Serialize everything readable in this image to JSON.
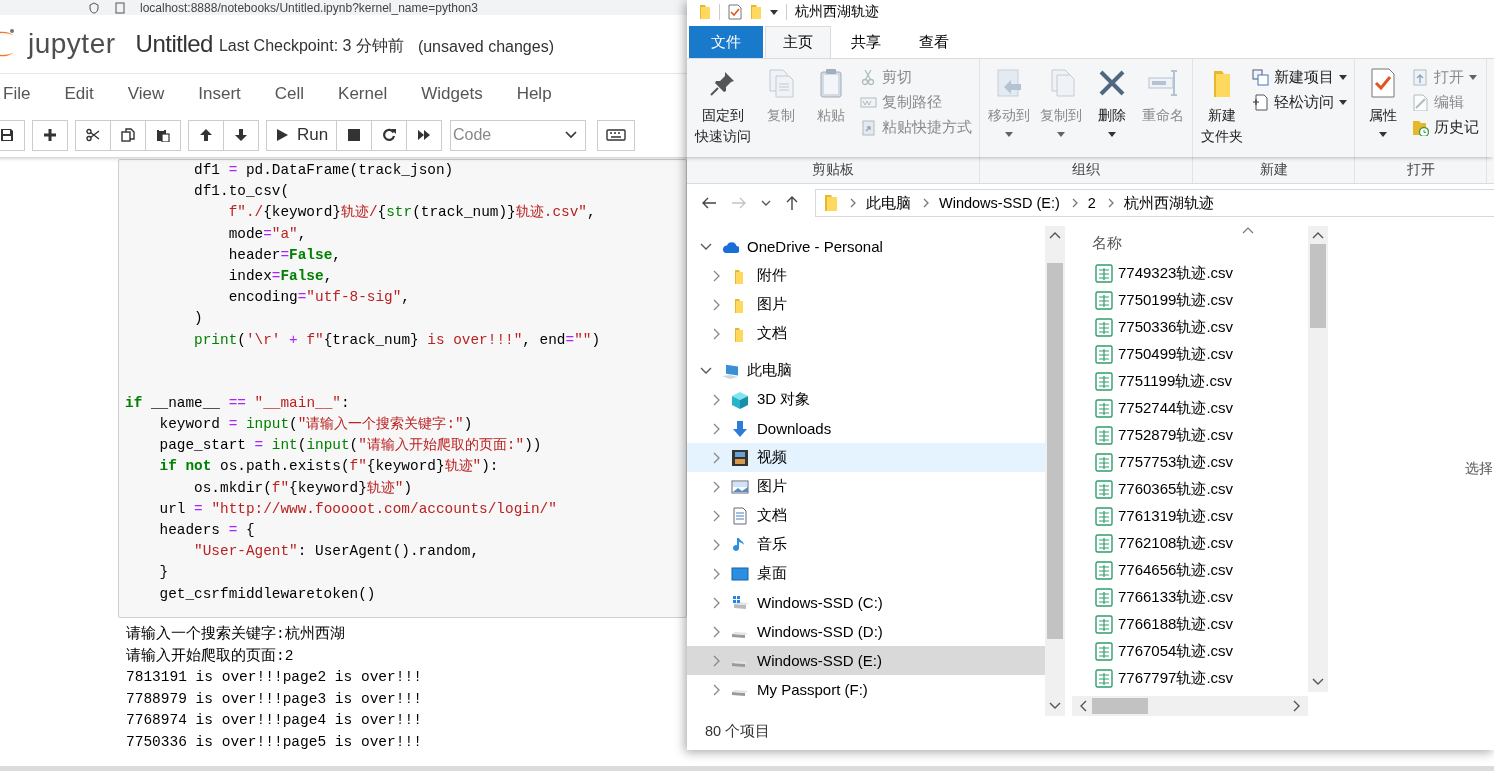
{
  "browser": {
    "url": "localhost:8888/notebooks/Untitled.ipynb?kernel_name=python3"
  },
  "jupyter": {
    "logo": "jupyter",
    "title": "Untitled",
    "checkpoint": "Last Checkpoint: 3 分钟前",
    "unsaved": "(unsaved changes)",
    "menu": [
      "File",
      "Edit",
      "View",
      "Insert",
      "Cell",
      "Kernel",
      "Widgets",
      "Help"
    ],
    "toolbar": {
      "run_label": "Run",
      "cell_type": "Code"
    },
    "code_blocks": [
      {
        "lines": [
          [
            {
              "kind": "plain",
              "text": "        df1 "
            },
            {
              "kind": "op",
              "text": "= "
            },
            {
              "kind": "plain",
              "text": "pd.DataFrame(track_json)"
            }
          ],
          [
            {
              "kind": "plain",
              "text": "        df1.to_csv("
            }
          ],
          [
            {
              "kind": "str",
              "text": "            f\"./"
            },
            {
              "kind": "plain",
              "text": "{keyword}"
            },
            {
              "kind": "str",
              "text": "轨迹/"
            },
            {
              "kind": "plain",
              "text": "{"
            },
            {
              "kind": "builtin",
              "text": "str"
            },
            {
              "kind": "plain",
              "text": "(track_num)}"
            },
            {
              "kind": "str",
              "text": "轨迹.csv\""
            },
            {
              "kind": "plain",
              "text": ","
            }
          ],
          [
            {
              "kind": "plain",
              "text": "            mode"
            },
            {
              "kind": "op",
              "text": "="
            },
            {
              "kind": "str",
              "text": "\"a\""
            },
            {
              "kind": "plain",
              "text": ","
            }
          ],
          [
            {
              "kind": "plain",
              "text": "            header"
            },
            {
              "kind": "op",
              "text": "="
            },
            {
              "kind": "kw",
              "text": "False"
            },
            {
              "kind": "plain",
              "text": ","
            }
          ],
          [
            {
              "kind": "plain",
              "text": "            index"
            },
            {
              "kind": "op",
              "text": "="
            },
            {
              "kind": "kw",
              "text": "False"
            },
            {
              "kind": "plain",
              "text": ","
            }
          ],
          [
            {
              "kind": "plain",
              "text": "            encoding"
            },
            {
              "kind": "op",
              "text": "="
            },
            {
              "kind": "str",
              "text": "\"utf-8-sig\""
            },
            {
              "kind": "plain",
              "text": ","
            }
          ],
          [
            {
              "kind": "plain",
              "text": "        )"
            }
          ],
          [
            {
              "kind": "builtin",
              "text": "        print"
            },
            {
              "kind": "plain",
              "text": "("
            },
            {
              "kind": "str",
              "text": "'\\r'"
            },
            {
              "kind": "op",
              "text": " + "
            },
            {
              "kind": "str",
              "text": "f\""
            },
            {
              "kind": "plain",
              "text": "{track_num}"
            },
            {
              "kind": "str",
              "text": " is over!!!\""
            },
            {
              "kind": "plain",
              "text": ", end"
            },
            {
              "kind": "op",
              "text": "="
            },
            {
              "kind": "str",
              "text": "\"\""
            },
            {
              "kind": "plain",
              "text": ")"
            }
          ]
        ]
      },
      {
        "lines": [
          [
            {
              "kind": "kw",
              "text": "if"
            },
            {
              "kind": "plain",
              "text": " __name__ "
            },
            {
              "kind": "op",
              "text": "== "
            },
            {
              "kind": "str",
              "text": "\"__main__\""
            },
            {
              "kind": "plain",
              "text": ":"
            }
          ],
          [
            {
              "kind": "plain",
              "text": "    keyword "
            },
            {
              "kind": "op",
              "text": "= "
            },
            {
              "kind": "builtin",
              "text": "input"
            },
            {
              "kind": "plain",
              "text": "("
            },
            {
              "kind": "str",
              "text": "\"请输入一个搜索关键字:\""
            },
            {
              "kind": "plain",
              "text": ")"
            }
          ],
          [
            {
              "kind": "plain",
              "text": "    page_start "
            },
            {
              "kind": "op",
              "text": "= "
            },
            {
              "kind": "builtin",
              "text": "int"
            },
            {
              "kind": "plain",
              "text": "("
            },
            {
              "kind": "builtin",
              "text": "input"
            },
            {
              "kind": "plain",
              "text": "("
            },
            {
              "kind": "str",
              "text": "\"请输入开始爬取的页面:\""
            },
            {
              "kind": "plain",
              "text": "))"
            }
          ],
          [
            {
              "kind": "kw",
              "text": "    if not"
            },
            {
              "kind": "plain",
              "text": " os.path.exists("
            },
            {
              "kind": "str",
              "text": "f\""
            },
            {
              "kind": "plain",
              "text": "{keyword}"
            },
            {
              "kind": "str",
              "text": "轨迹\""
            },
            {
              "kind": "plain",
              "text": "):"
            }
          ],
          [
            {
              "kind": "plain",
              "text": "        os.mkdir("
            },
            {
              "kind": "str",
              "text": "f\""
            },
            {
              "kind": "plain",
              "text": "{keyword}"
            },
            {
              "kind": "str",
              "text": "轨迹\""
            },
            {
              "kind": "plain",
              "text": ")"
            }
          ],
          [
            {
              "kind": "plain",
              "text": "    url "
            },
            {
              "kind": "op",
              "text": "= "
            },
            {
              "kind": "str",
              "text": "\"http://www.fooooot.com/accounts/login/\""
            }
          ],
          [
            {
              "kind": "plain",
              "text": "    headers "
            },
            {
              "kind": "op",
              "text": "="
            },
            {
              "kind": "plain",
              "text": " {"
            }
          ],
          [
            {
              "kind": "str",
              "text": "        \"User-Agent\""
            },
            {
              "kind": "plain",
              "text": ": UserAgent().random,"
            }
          ],
          [
            {
              "kind": "plain",
              "text": "    }"
            }
          ],
          [
            {
              "kind": "plain",
              "text": "    get_csrfmiddlewaretoken()"
            }
          ]
        ]
      }
    ],
    "output": [
      "请输入一个搜索关键字:杭州西湖",
      "请输入开始爬取的页面:2",
      "7813191 is over!!!page2 is over!!!",
      "7788979 is over!!!page3 is over!!!",
      "7768974 is over!!!page4 is over!!!",
      "7750336 is over!!!page5 is over!!!"
    ]
  },
  "explorer": {
    "title": "杭州西湖轨迹",
    "tabs": [
      {
        "label": "文件",
        "kind": "file",
        "selected": false
      },
      {
        "label": "主页",
        "kind": "tab",
        "selected": true
      },
      {
        "label": "共享",
        "kind": "tab",
        "selected": false
      },
      {
        "label": "查看",
        "kind": "tab",
        "selected": false
      }
    ],
    "ribbon": [
      {
        "label": "剪贴板",
        "large": [
          {
            "kind": "pin",
            "lines": [
              "固定到",
              "快速访问"
            ],
            "disabled": false,
            "menu": false
          },
          {
            "kind": "copy",
            "lines": [
              "复制"
            ],
            "disabled": true,
            "menu": false
          },
          {
            "kind": "paste",
            "lines": [
              "粘贴"
            ],
            "disabled": true,
            "menu": false
          }
        ],
        "small": [
          {
            "kind": "cut",
            "label": "剪切",
            "disabled": true,
            "menu": false
          },
          {
            "kind": "copypath",
            "label": "复制路径",
            "disabled": true,
            "menu": false
          },
          {
            "kind": "pasteshortcut",
            "label": "粘贴快捷方式",
            "disabled": true,
            "menu": false
          }
        ]
      },
      {
        "label": "组织",
        "large": [
          {
            "kind": "move",
            "lines": [
              "移动到"
            ],
            "disabled": true,
            "menu": true
          },
          {
            "kind": "copyto",
            "lines": [
              "复制到"
            ],
            "disabled": true,
            "menu": true
          },
          {
            "kind": "delete",
            "lines": [
              "删除"
            ],
            "disabled": false,
            "menu": true
          },
          {
            "kind": "rename",
            "lines": [
              "重命名"
            ],
            "disabled": true,
            "menu": false
          }
        ]
      },
      {
        "label": "新建",
        "large": [
          {
            "kind": "newfolder",
            "lines": [
              "新建",
              "文件夹"
            ],
            "disabled": false,
            "menu": false
          }
        ],
        "small": [
          {
            "kind": "newitem",
            "label": "新建项目",
            "disabled": false,
            "menu": true
          },
          {
            "kind": "easyaccess",
            "label": "轻松访问",
            "disabled": false,
            "menu": true
          }
        ]
      },
      {
        "label": "打开",
        "large": [
          {
            "kind": "properties",
            "lines": [
              "属性"
            ],
            "disabled": false,
            "menu": true
          }
        ],
        "small": [
          {
            "kind": "open",
            "label": "打开",
            "disabled": true,
            "menu": true
          },
          {
            "kind": "edit",
            "label": "编辑",
            "disabled": true,
            "menu": false
          },
          {
            "kind": "history",
            "label": "历史记",
            "disabled": false,
            "menu": false
          }
        ]
      }
    ],
    "crumbs": [
      "此电脑",
      "Windows-SSD (E:)",
      "2",
      "杭州西湖轨迹"
    ],
    "nav": [
      {
        "label": "OneDrive - Personal",
        "kind": "cloud",
        "expanded": true,
        "selected": false,
        "hovered": false,
        "children": [
          {
            "label": "附件",
            "kind": "folder",
            "expanded": false,
            "selected": false,
            "hovered": false
          },
          {
            "label": "图片",
            "kind": "folder",
            "expanded": false,
            "selected": false,
            "hovered": false
          },
          {
            "label": "文档",
            "kind": "folder",
            "expanded": false,
            "selected": false,
            "hovered": false
          }
        ]
      },
      {
        "label": "此电脑",
        "kind": "computer",
        "expanded": true,
        "selected": false,
        "hovered": false,
        "children": [
          {
            "label": "3D 对象",
            "kind": "objects3d",
            "expanded": false,
            "selected": false,
            "hovered": false
          },
          {
            "label": "Downloads",
            "kind": "downloads",
            "expanded": false,
            "selected": false,
            "hovered": false
          },
          {
            "label": "视频",
            "kind": "videos",
            "expanded": false,
            "selected": false,
            "hovered": true
          },
          {
            "label": "图片",
            "kind": "pictures",
            "expanded": false,
            "selected": false,
            "hovered": false
          },
          {
            "label": "文档",
            "kind": "documents",
            "expanded": false,
            "selected": false,
            "hovered": false
          },
          {
            "label": "音乐",
            "kind": "music",
            "expanded": false,
            "selected": false,
            "hovered": false
          },
          {
            "label": "桌面",
            "kind": "desktop",
            "expanded": false,
            "selected": false,
            "hovered": false
          },
          {
            "label": "Windows-SSD (C:)",
            "kind": "systemdrive",
            "expanded": false,
            "selected": false,
            "hovered": false
          },
          {
            "label": "Windows-SSD (D:)",
            "kind": "drive",
            "expanded": false,
            "selected": false,
            "hovered": false
          },
          {
            "label": "Windows-SSD (E:)",
            "kind": "drive",
            "expanded": false,
            "selected": true,
            "hovered": false
          },
          {
            "label": "My Passport (F:)",
            "kind": "drive",
            "expanded": false,
            "selected": false,
            "hovered": false
          }
        ]
      }
    ],
    "column": "名称",
    "files": [
      "7749323轨迹.csv",
      "7750199轨迹.csv",
      "7750336轨迹.csv",
      "7750499轨迹.csv",
      "7751199轨迹.csv",
      "7752744轨迹.csv",
      "7752879轨迹.csv",
      "7757753轨迹.csv",
      "7760365轨迹.csv",
      "7761319轨迹.csv",
      "7762108轨迹.csv",
      "7764656轨迹.csv",
      "7766133轨迹.csv",
      "7766188轨迹.csv",
      "7767054轨迹.csv",
      "7767797轨迹.csv"
    ],
    "preview_hint": "选择",
    "status": "80 个项目"
  }
}
